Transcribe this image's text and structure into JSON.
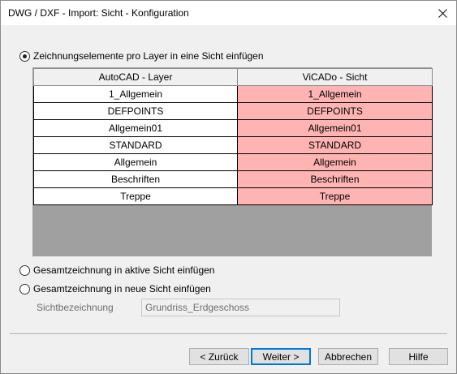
{
  "window": {
    "title": "DWG / DXF - Import: Sicht - Konfiguration"
  },
  "options": {
    "per_layer": "Zeichnungselemente pro Layer in eine Sicht einfügen",
    "active_view": "Gesamtzeichnung in aktive Sicht einfügen",
    "new_view": "Gesamtzeichnung in neue Sicht einfügen",
    "selected": "per_layer"
  },
  "mapping_table": {
    "headers": [
      "AutoCAD - Layer",
      "ViCADo - Sicht"
    ],
    "rows": [
      [
        "1_Allgemein",
        "1_Allgemein"
      ],
      [
        "DEFPOINTS",
        "DEFPOINTS"
      ],
      [
        "Allgemein01",
        "Allgemein01"
      ],
      [
        "STANDARD",
        "STANDARD"
      ],
      [
        "Allgemein",
        "Allgemein"
      ],
      [
        "Beschriften",
        "Beschriften"
      ],
      [
        "Treppe",
        "Treppe"
      ]
    ]
  },
  "view_name": {
    "label": "Sichtbezeichnung",
    "value": "Grundriss_Erdgeschoss"
  },
  "buttons": {
    "back": "< Zurück",
    "next": "Weiter >",
    "cancel": "Abbrechen",
    "help": "Hilfe"
  },
  "colors": {
    "target_cell": "#ffb4b4",
    "grid_empty_area": "#a0a0a0",
    "default_button_border": "#0078d7"
  },
  "icons": {
    "close": "close-icon"
  }
}
